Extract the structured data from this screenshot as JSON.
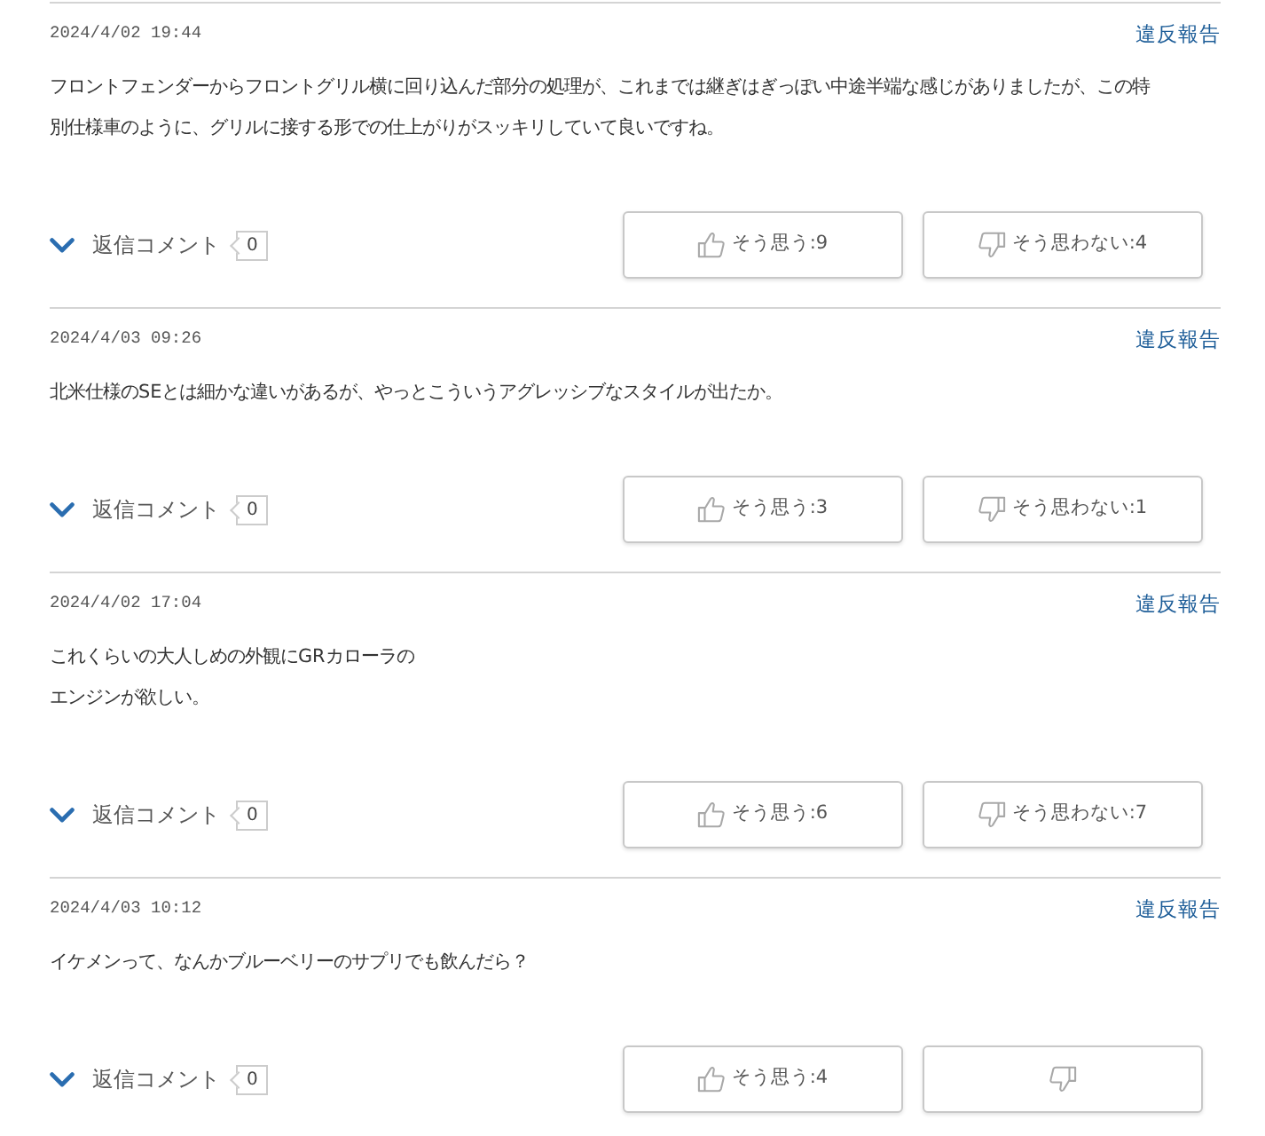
{
  "comments": [
    {
      "date": "2024/4/02 19:44",
      "report": "違反報告",
      "text": [
        "フロントフェンダーからフロントグリル横に回り込んだ部分の処理が、これまでは継ぎはぎっぽい中途半端な感じがありましたが、この特別仕様車のように、グリルに接する形での仕上がりがスッキリしていて良いですね。"
      ],
      "reply_label": "返信コメント",
      "reply_count": "0",
      "votes": [
        {
          "kind": "agree",
          "label": "そう思う:9"
        },
        {
          "kind": "disagree",
          "label": "そう思わない:4"
        }
      ]
    },
    {
      "date": "2024/4/03 09:26",
      "report": "違反報告",
      "text": [
        "北米仕様のSEとは細かな違いがあるが、やっとこういうアグレッシブなスタイルが出たか。"
      ],
      "reply_label": "返信コメント",
      "reply_count": "0",
      "votes": [
        {
          "kind": "agree",
          "label": "そう思う:3"
        },
        {
          "kind": "disagree",
          "label": "そう思わない:1"
        }
      ]
    },
    {
      "date": "2024/4/02 17:04",
      "report": "違反報告",
      "text": [
        "これくらいの大人しめの外観にGRカローラの",
        "エンジンが欲しい。"
      ],
      "reply_label": "返信コメント",
      "reply_count": "0",
      "votes": [
        {
          "kind": "agree",
          "label": "そう思う:6"
        },
        {
          "kind": "disagree",
          "label": "そう思わない:7"
        }
      ]
    },
    {
      "date": "2024/4/03 10:12",
      "report": "違反報告",
      "text": [
        "イケメンって、なんかブルーベリーのサプリでも飲んだら？"
      ],
      "reply_label": "返信コメント",
      "reply_count": "0",
      "votes": [
        {
          "kind": "agree",
          "label": "そう思う:4"
        },
        {
          "kind": "disagree"
        }
      ]
    }
  ]
}
